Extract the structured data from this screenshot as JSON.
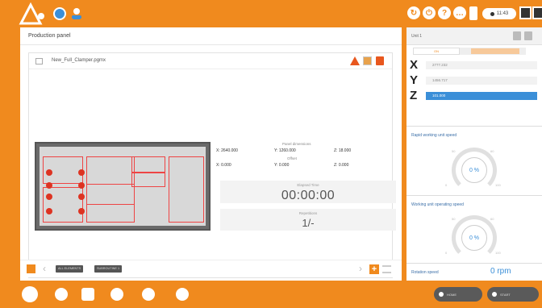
{
  "header": {
    "status_time": "11:43"
  },
  "left_panel": {
    "title": "Production panel",
    "file_name": "New_Full_Clamper.pgmx",
    "info": {
      "col1": [
        "X: 2640.000",
        "X: 0.000"
      ],
      "col2_caption": "Panel dimensions",
      "col2_sub": "Offset",
      "col2": [
        "Y: 1260.000",
        "Y: 0.000"
      ],
      "col3": [
        "Z: 18.000",
        "Z: 0.000"
      ]
    },
    "elapsed_caption": "Elapsed Time",
    "elapsed_time": "00:00:00",
    "repetitions_caption": "Repetitions",
    "repetitions": "1/-",
    "footer_note": "Units: millimeters, front dimensions: origin",
    "program_tags": [
      "ALL ELEMENTS",
      "SUBROUTINE 1"
    ]
  },
  "right_panel": {
    "unit_label": "Unit 1",
    "segment_on": "ON",
    "axes": [
      {
        "letter": "X",
        "value": "2777.232",
        "active": false
      },
      {
        "letter": "Y",
        "value": "1456.717",
        "active": false
      },
      {
        "letter": "Z",
        "value": "101.000",
        "active": true
      }
    ],
    "gauge1_title": "Rapid working unit speed",
    "gauge1_value": "0 %",
    "gauge2_title": "Working unit operating speed",
    "gauge2_value": "0 %",
    "gauge_ticks": [
      "50",
      "60",
      "70",
      "80",
      "0",
      "100"
    ],
    "rotation_label": "Rotation speed",
    "rotation_value": "0 rpm"
  },
  "footer": {
    "pills": [
      "HOME",
      "START"
    ]
  },
  "colors": {
    "accent": "#f08a1e",
    "blue": "#3b8fd8",
    "clamp": "#dd3322"
  }
}
